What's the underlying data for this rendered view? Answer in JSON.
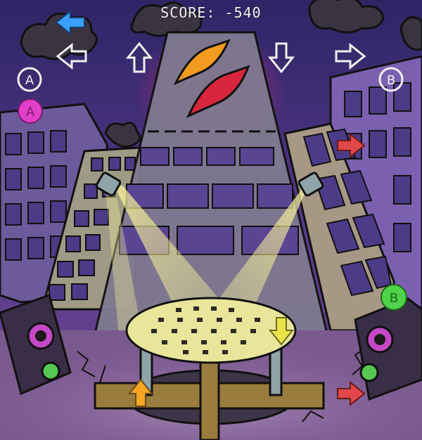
{
  "hud": {
    "score_label": "SCORE:",
    "score_value": "-540"
  },
  "buttons": {
    "a_label": "A",
    "b_label": "B",
    "a_active_label": "A",
    "b_active_label": "B"
  },
  "receptors": [
    "left",
    "up",
    "down",
    "right"
  ],
  "notes": [
    {
      "lane": "left",
      "color": "#3aa0ff",
      "state": "hit"
    },
    {
      "lane": "right",
      "color": "#e0484a",
      "state": "falling"
    },
    {
      "lane": "up",
      "color": "#f5a623",
      "state": "falling"
    },
    {
      "lane": "down",
      "color": "#e9e24a",
      "state": "falling"
    },
    {
      "lane": "right",
      "color": "#e0484a",
      "state": "falling"
    }
  ],
  "colors": {
    "sky": "#3b2a6b",
    "accent_pink": "#e040c8",
    "accent_green": "#4fd14a",
    "spotlight": "#fbf59a"
  }
}
